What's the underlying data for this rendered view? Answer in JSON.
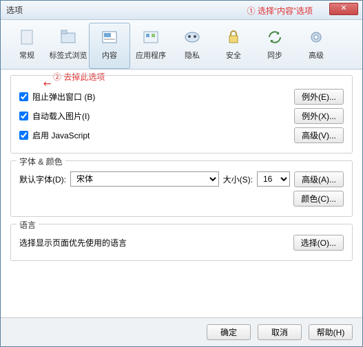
{
  "window": {
    "title": "选项"
  },
  "annotations": {
    "a1": "① 选择“内容”选项",
    "a2": "② 去掉此选项"
  },
  "toolbar": [
    {
      "id": "general",
      "label": "常规"
    },
    {
      "id": "tabs",
      "label": "标签式浏览"
    },
    {
      "id": "content",
      "label": "内容",
      "active": true
    },
    {
      "id": "apps",
      "label": "应用程序"
    },
    {
      "id": "privacy",
      "label": "隐私"
    },
    {
      "id": "security",
      "label": "安全"
    },
    {
      "id": "sync",
      "label": "同步"
    },
    {
      "id": "advanced",
      "label": "高级"
    }
  ],
  "checkboxes": {
    "popup": "阻止弹出窗口 (B)",
    "images": "自动载入图片(I)",
    "js": "启用 JavaScript"
  },
  "buttons": {
    "except_e": "例外(E)...",
    "except_x": "例外(X)...",
    "adv_v": "高级(V)...",
    "adv_a": "高级(A)...",
    "color_c": "颜色(C)...",
    "choose_o": "选择(O)...",
    "ok": "确定",
    "cancel": "取消",
    "help": "帮助(H)"
  },
  "fonts": {
    "group_title": "字体 & 颜色",
    "label": "默认字体(D):",
    "font_value": "宋体",
    "size_label": "大小(S):",
    "size_value": "16"
  },
  "language": {
    "group_title": "语言",
    "desc": "选择显示页面优先使用的语言"
  }
}
